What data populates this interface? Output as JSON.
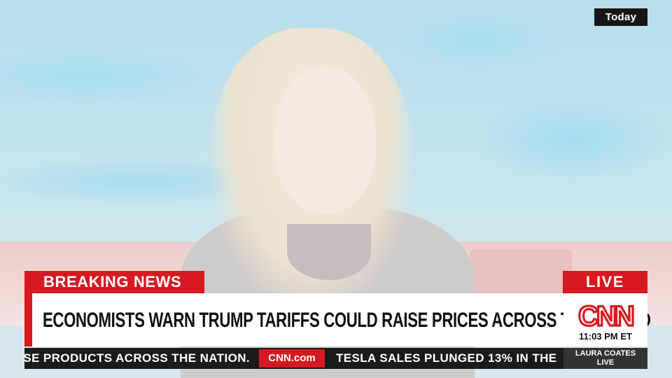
{
  "corner_tag": {
    "label": "Today"
  },
  "lower_third": {
    "label": "BREAKING NEWS",
    "headline": "ECONOMISTS WARN TRUMP TARIFFS COULD RAISE PRICES ACROSS THE BOARD",
    "live_label": "LIVE",
    "network_logo": "CNN",
    "clock": "11:03 PM ET",
    "accent_color": "#d71921"
  },
  "ticker": {
    "left_text": "SE PRODUCTS ACROSS THE NATION.",
    "site_logo": "CNN.com",
    "right_text": "TESLA SALES PLUNGED 13% IN THE",
    "show_line1": "LAURA COATES",
    "show_line2": "LIVE"
  }
}
